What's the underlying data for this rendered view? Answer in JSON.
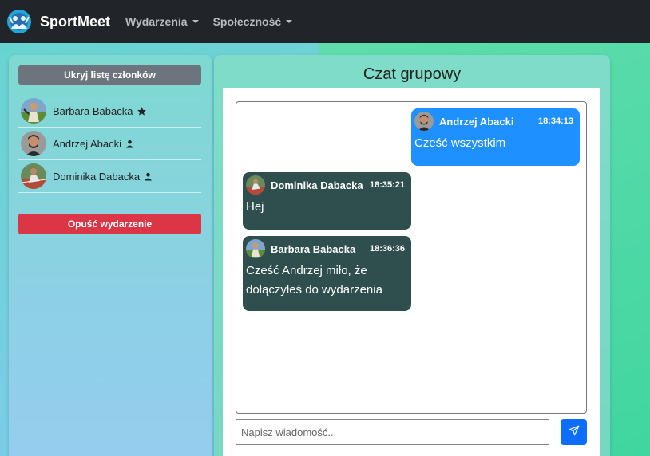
{
  "navbar": {
    "brand": "SportMeet",
    "menu": [
      {
        "label": "Wydarzenia"
      },
      {
        "label": "Społeczność"
      }
    ]
  },
  "sidebar": {
    "hide_members_label": "Ukryj listę członków",
    "members": [
      {
        "name": "Barbara Babacka",
        "role_icon": "star-icon"
      },
      {
        "name": "Andrzej Abacki",
        "role_icon": "user-icon"
      },
      {
        "name": "Dominika Dabacka",
        "role_icon": "user-icon"
      }
    ],
    "leave_label": "Opuść wydarzenie"
  },
  "chat": {
    "title": "Czat grupowy",
    "messages": [
      {
        "author": "Andrzej Abacki",
        "time": "18:34:13",
        "text": "Cześć wszystkim",
        "own": true
      },
      {
        "author": "Dominika Dabacka",
        "time": "18:35:21",
        "text": "Hej",
        "own": false
      },
      {
        "author": "Barbara Babacka",
        "time": "18:36:36",
        "text": "Cześć Andrzej miło, że dołączyłeś do wydarzenia",
        "own": false
      }
    ],
    "input_placeholder": "Napisz wiadomość...",
    "send_icon": "send-icon"
  },
  "colors": {
    "own_message": "#1e90ff",
    "other_message": "#2f4f4f",
    "leave_button": "#dc3545",
    "hide_button": "#6c757d",
    "send_button": "#0d6efd"
  }
}
